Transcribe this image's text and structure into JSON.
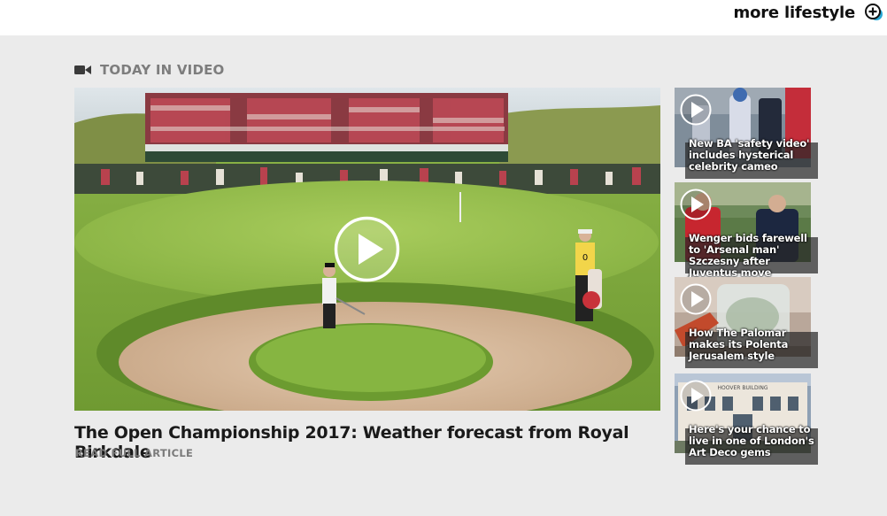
{
  "topbar": {
    "more_label": "more lifestyle",
    "more_icon": "plus-circle-icon"
  },
  "section": {
    "title": "TODAY IN VIDEO",
    "icon": "video-camera-icon"
  },
  "main_video": {
    "headline": "The Open Championship 2017: Weather forecast from Royal Birkdale",
    "read_more": "READ FULL ARTICLE",
    "play_icon": "play-icon"
  },
  "side_videos": [
    {
      "caption": "New BA 'safety video' includes hysterical celebrity cameo",
      "play_icon": "play-icon"
    },
    {
      "caption": "Wenger bids farewell to 'Arsenal man' Szczesny after Juventus move",
      "play_icon": "play-icon"
    },
    {
      "caption": "How The Palomar makes its Polenta Jerusalem style",
      "play_icon": "play-icon"
    },
    {
      "caption": "Here's your chance to live in one of London's Art Deco gems",
      "play_icon": "play-icon",
      "sign_text": "HOOVER BUILDING"
    }
  ],
  "colors": {
    "accent": "#29a8d6",
    "section_title": "#7d7d7d",
    "page_background": "#ebebeb"
  }
}
